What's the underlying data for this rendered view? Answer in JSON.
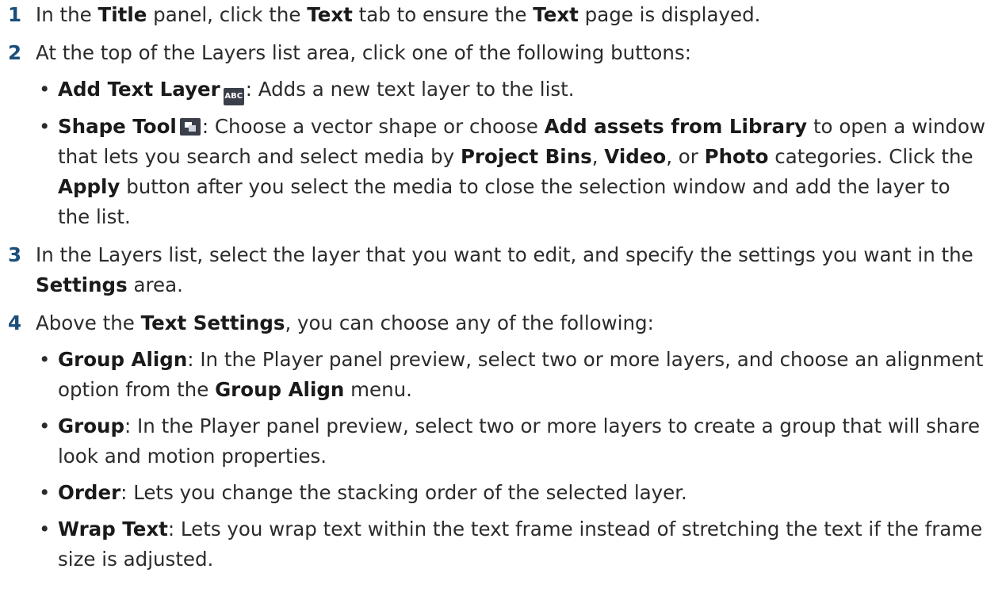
{
  "steps": [
    {
      "num": "1",
      "parts": [
        {
          "t": "In the "
        },
        {
          "t": "Title",
          "b": true
        },
        {
          "t": " panel, click the "
        },
        {
          "t": "Text",
          "b": true
        },
        {
          "t": " tab to ensure the "
        },
        {
          "t": "Text",
          "b": true
        },
        {
          "t": " page is displayed."
        }
      ]
    },
    {
      "num": "2",
      "parts": [
        {
          "t": "At the top of the Layers list area, click one of the following buttons:"
        }
      ],
      "bullets": [
        [
          {
            "t": "Add Text Layer",
            "b": true
          },
          {
            "icon": "abc-text-layer-icon",
            "label": "ABC"
          },
          {
            "t": ": Adds a new text layer to the list."
          }
        ],
        [
          {
            "t": "Shape Tool",
            "b": true
          },
          {
            "icon": "shape-tool-icon"
          },
          {
            "t": ": Choose a vector shape or choose "
          },
          {
            "t": "Add assets from Library",
            "b": true
          },
          {
            "t": " to open a window that lets you search and select media by "
          },
          {
            "t": "Project Bins",
            "b": true
          },
          {
            "t": ", "
          },
          {
            "t": "Video",
            "b": true
          },
          {
            "t": ", or "
          },
          {
            "t": "Photo",
            "b": true
          },
          {
            "t": " categories. Click the "
          },
          {
            "t": "Apply",
            "b": true
          },
          {
            "t": " button after you select the media to close the selection window and add the layer to the list."
          }
        ]
      ]
    },
    {
      "num": "3",
      "parts": [
        {
          "t": "In the Layers list, select the layer that you want to edit, and specify the settings you want in the "
        },
        {
          "t": "Settings",
          "b": true
        },
        {
          "t": " area."
        }
      ]
    },
    {
      "num": "4",
      "parts": [
        {
          "t": "Above the "
        },
        {
          "t": "Text Settings",
          "b": true
        },
        {
          "t": ", you can choose any of the following:"
        }
      ],
      "bullets": [
        [
          {
            "t": "Group Align",
            "b": true
          },
          {
            "t": ": In the Player panel preview, select two or more layers, and choose an alignment option from the "
          },
          {
            "t": "Group Align",
            "b": true
          },
          {
            "t": " menu."
          }
        ],
        [
          {
            "t": "Group",
            "b": true
          },
          {
            "t": ": In the Player panel preview, select two or more layers to create a group that will share look and motion properties."
          }
        ],
        [
          {
            "t": "Order",
            "b": true
          },
          {
            "t": ": Lets you change the stacking order of the selected layer."
          }
        ],
        [
          {
            "t": "Wrap Text",
            "b": true
          },
          {
            "t": ": Lets you wrap text within the text frame instead of stretching the text if the frame size is adjusted."
          }
        ]
      ]
    }
  ],
  "bullet_char": "•",
  "colors": {
    "step_number": "#1b4f7a",
    "icon_bg": "#3a3f4a",
    "text": "#2b2b2b"
  }
}
